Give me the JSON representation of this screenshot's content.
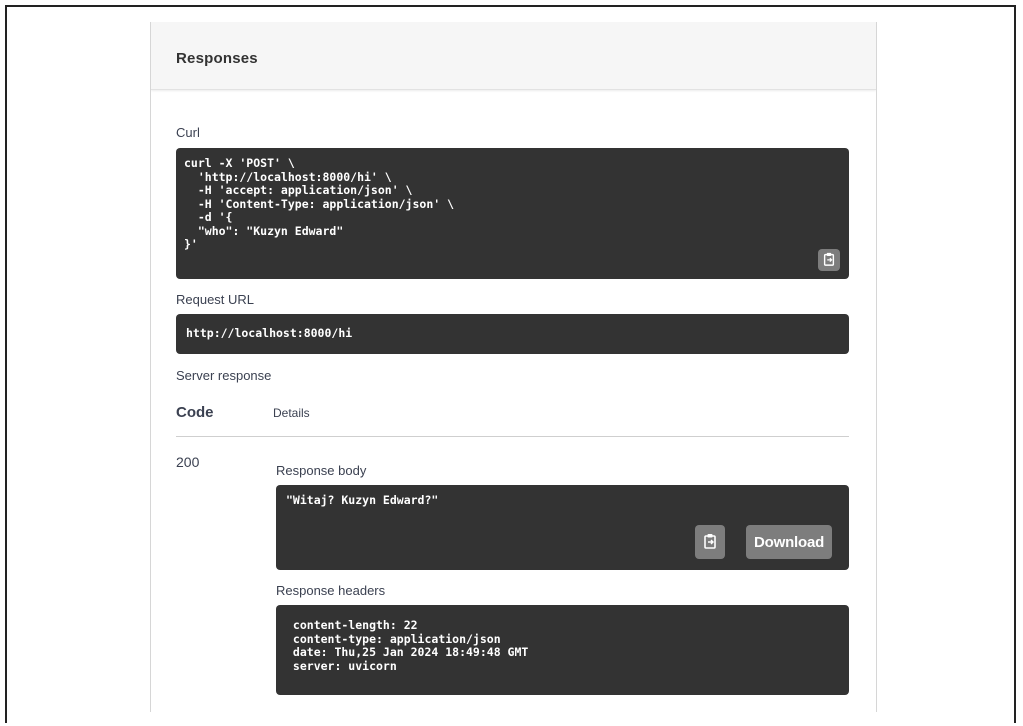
{
  "panel": {
    "title": "Responses"
  },
  "curl": {
    "label": "Curl",
    "command": "curl -X 'POST' \\\n  'http://localhost:8000/hi' \\\n  -H 'accept: application/json' \\\n  -H 'Content-Type: application/json' \\\n  -d '{\n  \"who\": \"Kuzyn Edward\"\n}'",
    "copy_icon": "clipboard-icon"
  },
  "request_url": {
    "label": "Request URL",
    "value": "http://localhost:8000/hi"
  },
  "server_response": {
    "label": "Server response",
    "columns": [
      "Code",
      "Details"
    ],
    "code": "200",
    "response_body": {
      "label": "Response body",
      "value": "\"Witaj? Kuzyn Edward?\"",
      "download_label": "Download",
      "copy_icon": "clipboard-icon"
    },
    "response_headers": {
      "label": "Response headers",
      "value": " content-length: 22\n content-type: application/json\n date: Thu,25 Jan 2024 18:49:48 GMT\n server: uvicorn"
    }
  },
  "colors": {
    "dark_box": "#333333",
    "button_gray": "#7d7d7d",
    "header_bg": "#f6f6f6"
  }
}
